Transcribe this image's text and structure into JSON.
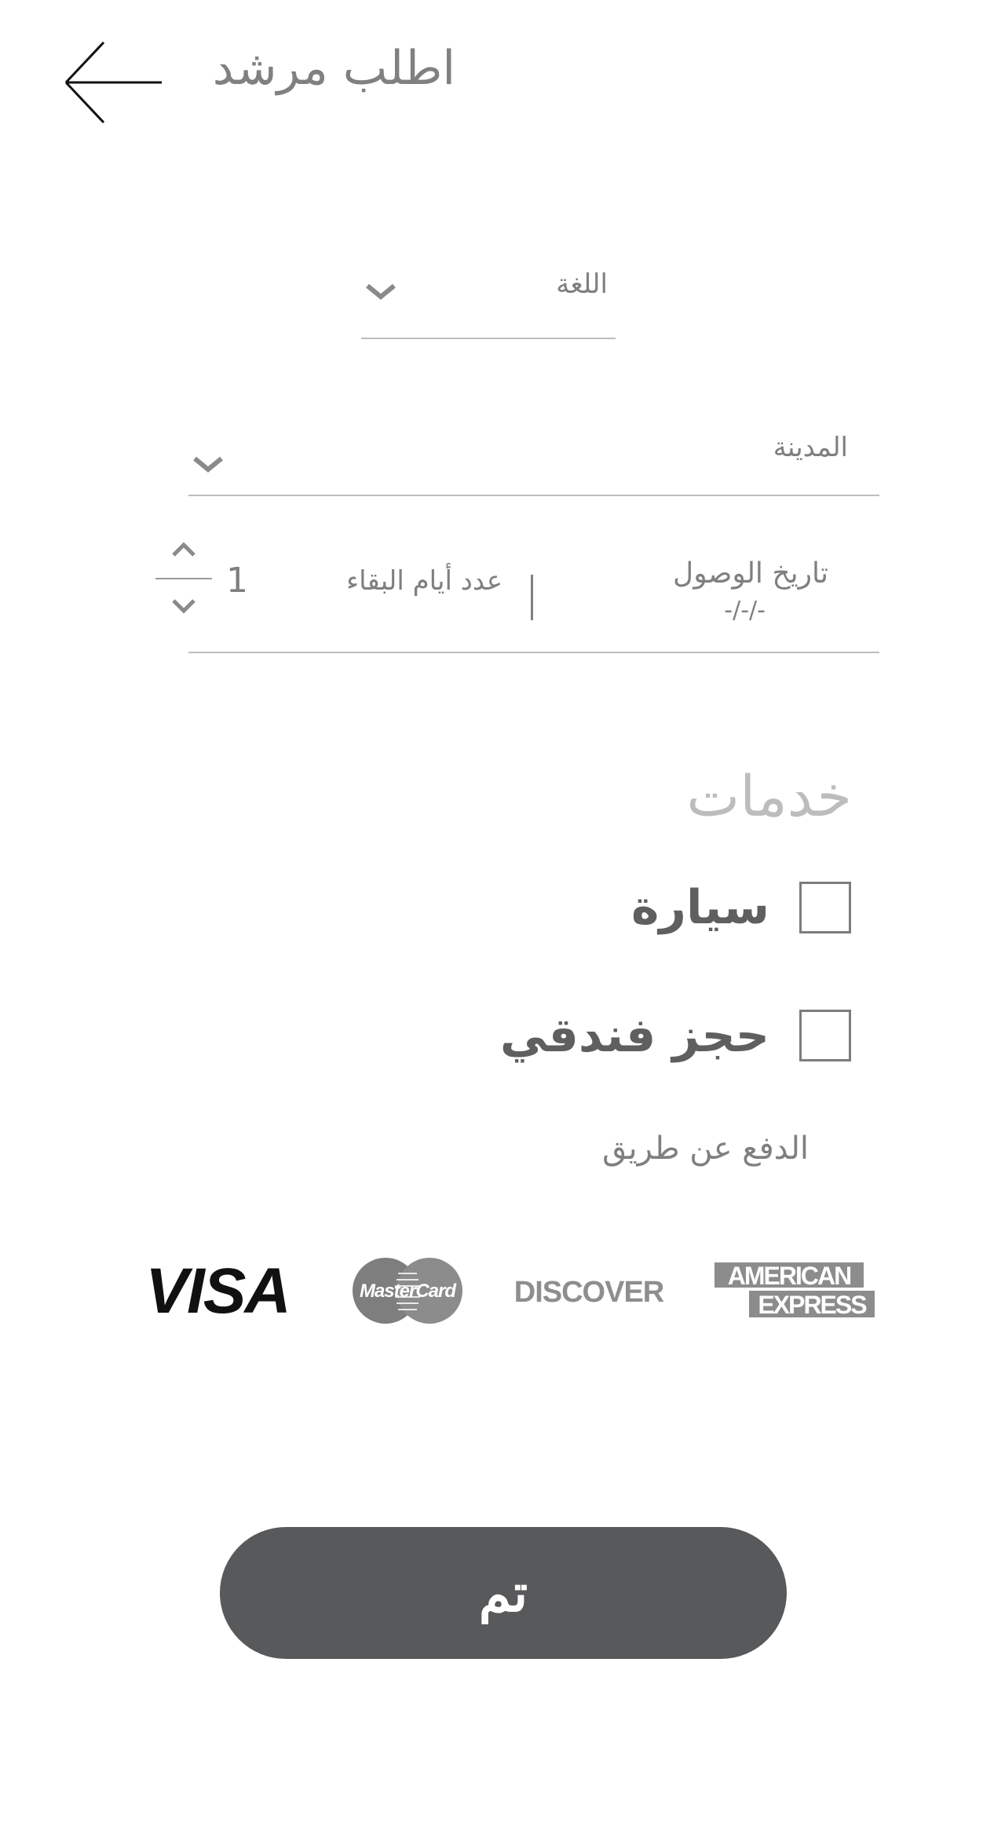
{
  "header": {
    "title": "اطلب مرشد",
    "back_icon": "arrow-left-icon"
  },
  "form": {
    "language": {
      "label": "اللغة",
      "icon": "chevron-down-icon"
    },
    "city": {
      "label": "المدينة",
      "icon": "chevron-down-icon"
    },
    "arrival": {
      "label": "تاريخ الوصول",
      "value": "-/-/-"
    },
    "stay": {
      "label": "عدد أيام البقاء",
      "value": "1",
      "up_icon": "chevron-up-icon",
      "down_icon": "chevron-down-icon"
    }
  },
  "services": {
    "heading": "خدمات",
    "items": [
      {
        "label": "سيارة",
        "checked": false
      },
      {
        "label": "حجز فندقي",
        "checked": false
      }
    ]
  },
  "payment": {
    "label": "الدفع عن طريق",
    "methods": [
      {
        "name": "VISA"
      },
      {
        "name": "MasterCard"
      },
      {
        "name": "DISCOVER"
      },
      {
        "name": "AMERICAN EXPRESS"
      }
    ]
  },
  "actions": {
    "done_label": "تم"
  },
  "colors": {
    "button_bg": "#58595b",
    "text_muted": "#7f7f7f",
    "heading_light": "#bdbdbd"
  }
}
